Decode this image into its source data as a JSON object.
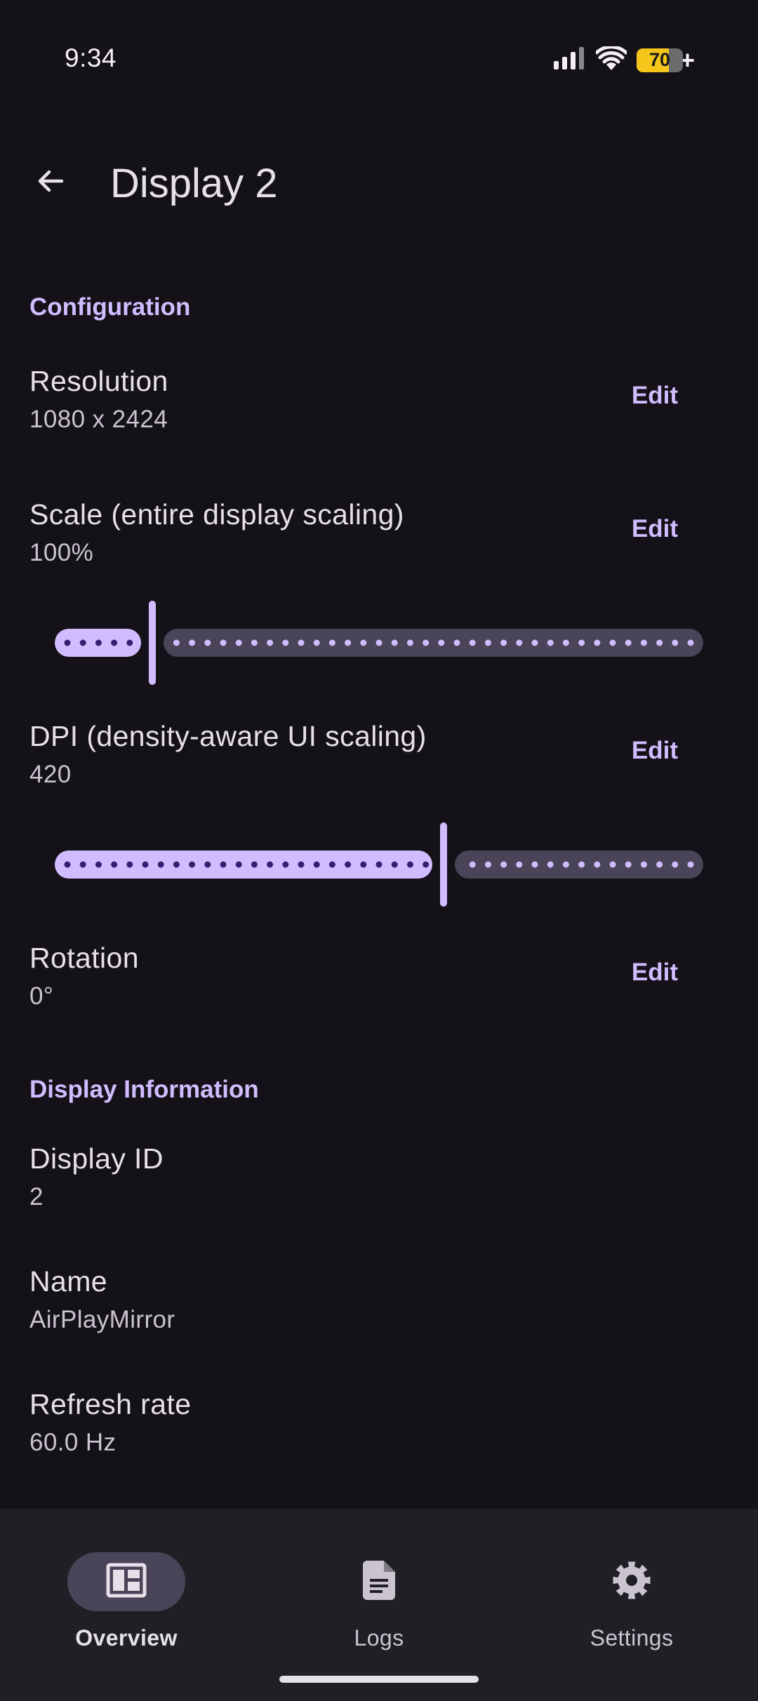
{
  "status_bar": {
    "time": "9:34",
    "battery_level": "70",
    "battery_charging_symbol": "+"
  },
  "app_bar": {
    "title": "Display 2",
    "back_icon": "arrow-back-icon"
  },
  "configuration": {
    "header": "Configuration",
    "resolution": {
      "title": "Resolution",
      "value": "1080 x 2424",
      "action": "Edit"
    },
    "scale": {
      "title": "Scale (entire display scaling)",
      "value": "100%",
      "action": "Edit",
      "slider_fraction": 0.15,
      "slider_steps": 40
    },
    "dpi": {
      "title": "DPI (density-aware UI scaling)",
      "value": "420",
      "action": "Edit",
      "slider_fraction": 0.6,
      "slider_steps": 40
    },
    "rotation": {
      "title": "Rotation",
      "value": "0°",
      "action": "Edit"
    }
  },
  "display_information": {
    "header": "Display Information",
    "display_id": {
      "title": "Display ID",
      "value": "2"
    },
    "name": {
      "title": "Name",
      "value": "AirPlayMirror"
    },
    "refresh_rate": {
      "title": "Refresh rate",
      "value": "60.0 Hz"
    }
  },
  "bottom_nav": {
    "items": [
      {
        "label": "Overview",
        "icon": "dashboard-icon",
        "active": true
      },
      {
        "label": "Logs",
        "icon": "document-icon",
        "active": false
      },
      {
        "label": "Settings",
        "icon": "gear-icon",
        "active": false
      }
    ]
  },
  "colors": {
    "background": "#141218",
    "accent": "#D0BCFF",
    "track_inactive": "#4A4458",
    "battery": "#F5C51A"
  }
}
